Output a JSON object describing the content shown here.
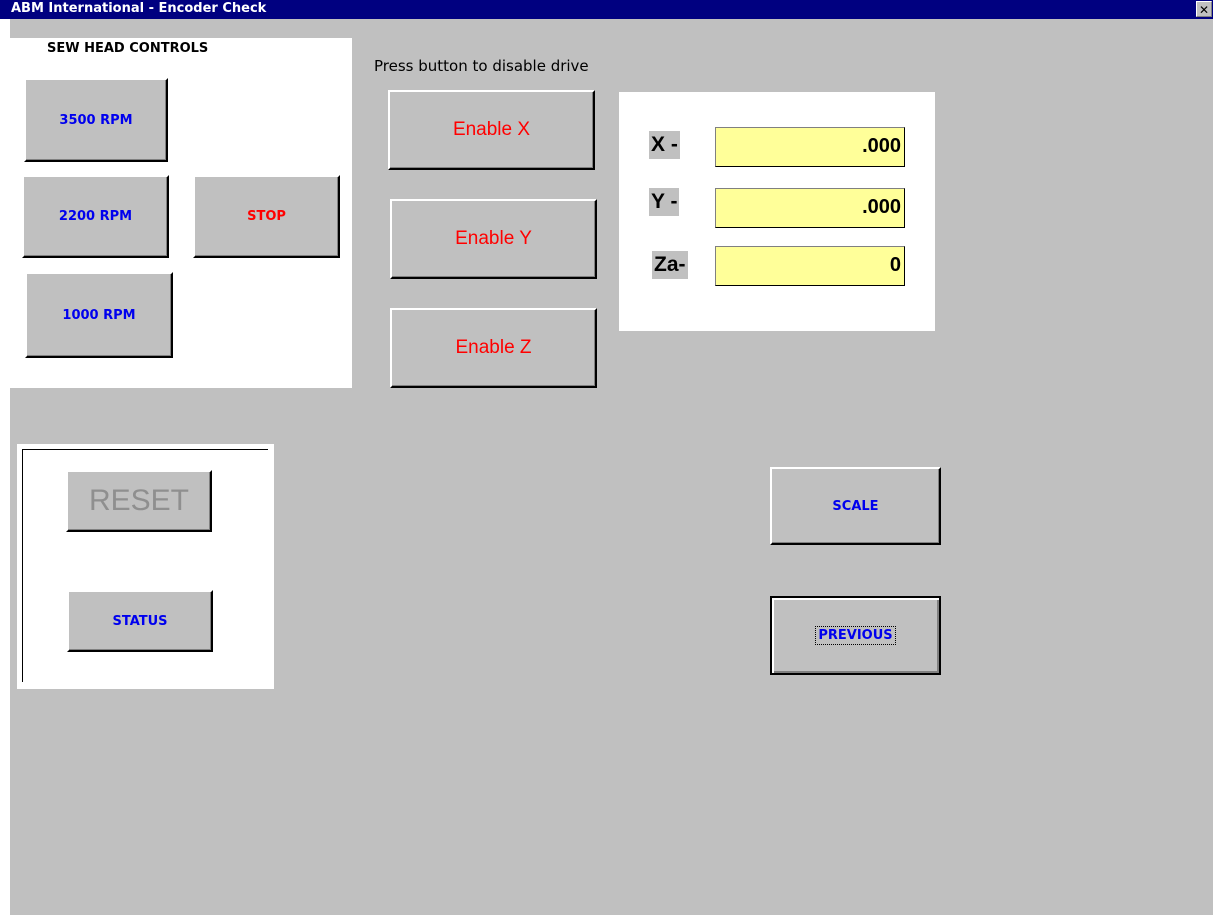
{
  "window": {
    "title": "ABM International - Encoder Check",
    "close_glyph": "✕"
  },
  "sew_head": {
    "title": "SEW HEAD CONTROLS",
    "buttons": {
      "rpm_3500": "3500 RPM",
      "rpm_2200": "2200 RPM",
      "stop": "STOP",
      "rpm_1000": "1000 RPM"
    }
  },
  "drives": {
    "instruction": "Press button to disable drive",
    "enable_x": "Enable X",
    "enable_y": "Enable Y",
    "enable_z": "Enable Z"
  },
  "encoders": {
    "x_label": "X -",
    "x_value": ".000",
    "y_label": "Y -",
    "y_value": ".000",
    "z_label": "Za-",
    "z_value": "0"
  },
  "status_panel": {
    "reset": "RESET",
    "status": "STATUS"
  },
  "actions": {
    "scale": "SCALE",
    "previous": "PREVIOUS"
  },
  "colors": {
    "titlebar": "#000080",
    "background": "#c0c0c0",
    "blue_text": "#0000ee",
    "red_text": "#ff0000",
    "field_yellow": "#ffff99",
    "disabled_text": "#8f8f8f"
  }
}
